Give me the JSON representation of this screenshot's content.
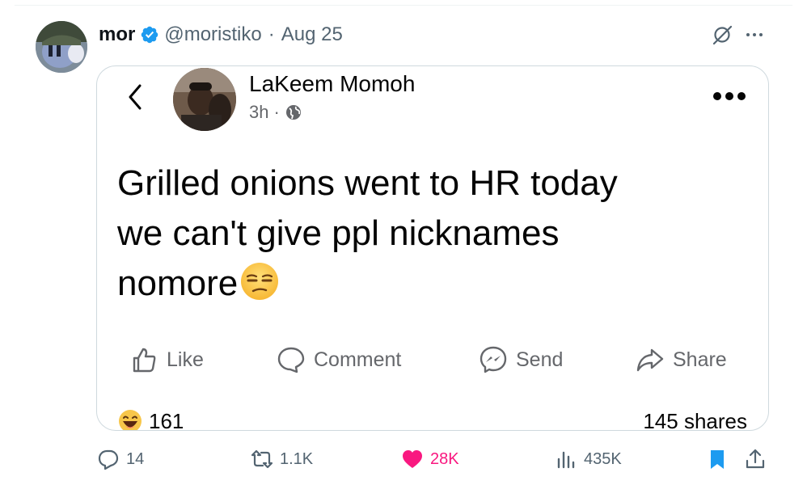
{
  "tweet": {
    "display_name": "mor",
    "handle": "@moristiko",
    "separator": "·",
    "date": "Aug 25"
  },
  "screenshot": {
    "author": "LaKeem Momoh",
    "time": "3h",
    "meta_separator": "·",
    "text_lines": [
      "Grilled onions went to HR today",
      "we can't give ppl nicknames",
      "nomore"
    ],
    "actions": {
      "like": "Like",
      "comment": "Comment",
      "send": "Send",
      "share": "Share"
    },
    "reaction_count": "161",
    "shares": "145 shares"
  },
  "tweet_actions": {
    "replies": "14",
    "reposts": "1.1K",
    "likes": "28K",
    "views": "435K"
  },
  "icons": {
    "verified": "verified-badge-icon",
    "grok": "grok-icon",
    "more": "more-icon",
    "back": "back-chevron-icon",
    "globe": "globe-icon",
    "thumbs_up": "thumbs-up-icon",
    "comment": "comment-bubble-icon",
    "messenger": "messenger-icon",
    "share_arrow": "share-arrow-icon",
    "laugh_emoji": "laughing-emoji-icon",
    "unamused_emoji": "unamused-emoji-icon",
    "reply": "reply-icon",
    "retweet": "retweet-icon",
    "heart": "heart-icon",
    "views": "views-icon",
    "bookmark": "bookmark-icon",
    "share": "share-icon"
  },
  "colors": {
    "verified_blue": "#1d9bf0",
    "like_pink": "#f91880",
    "secondary_text": "#536471",
    "bookmark_blue": "#1d9bf0"
  }
}
